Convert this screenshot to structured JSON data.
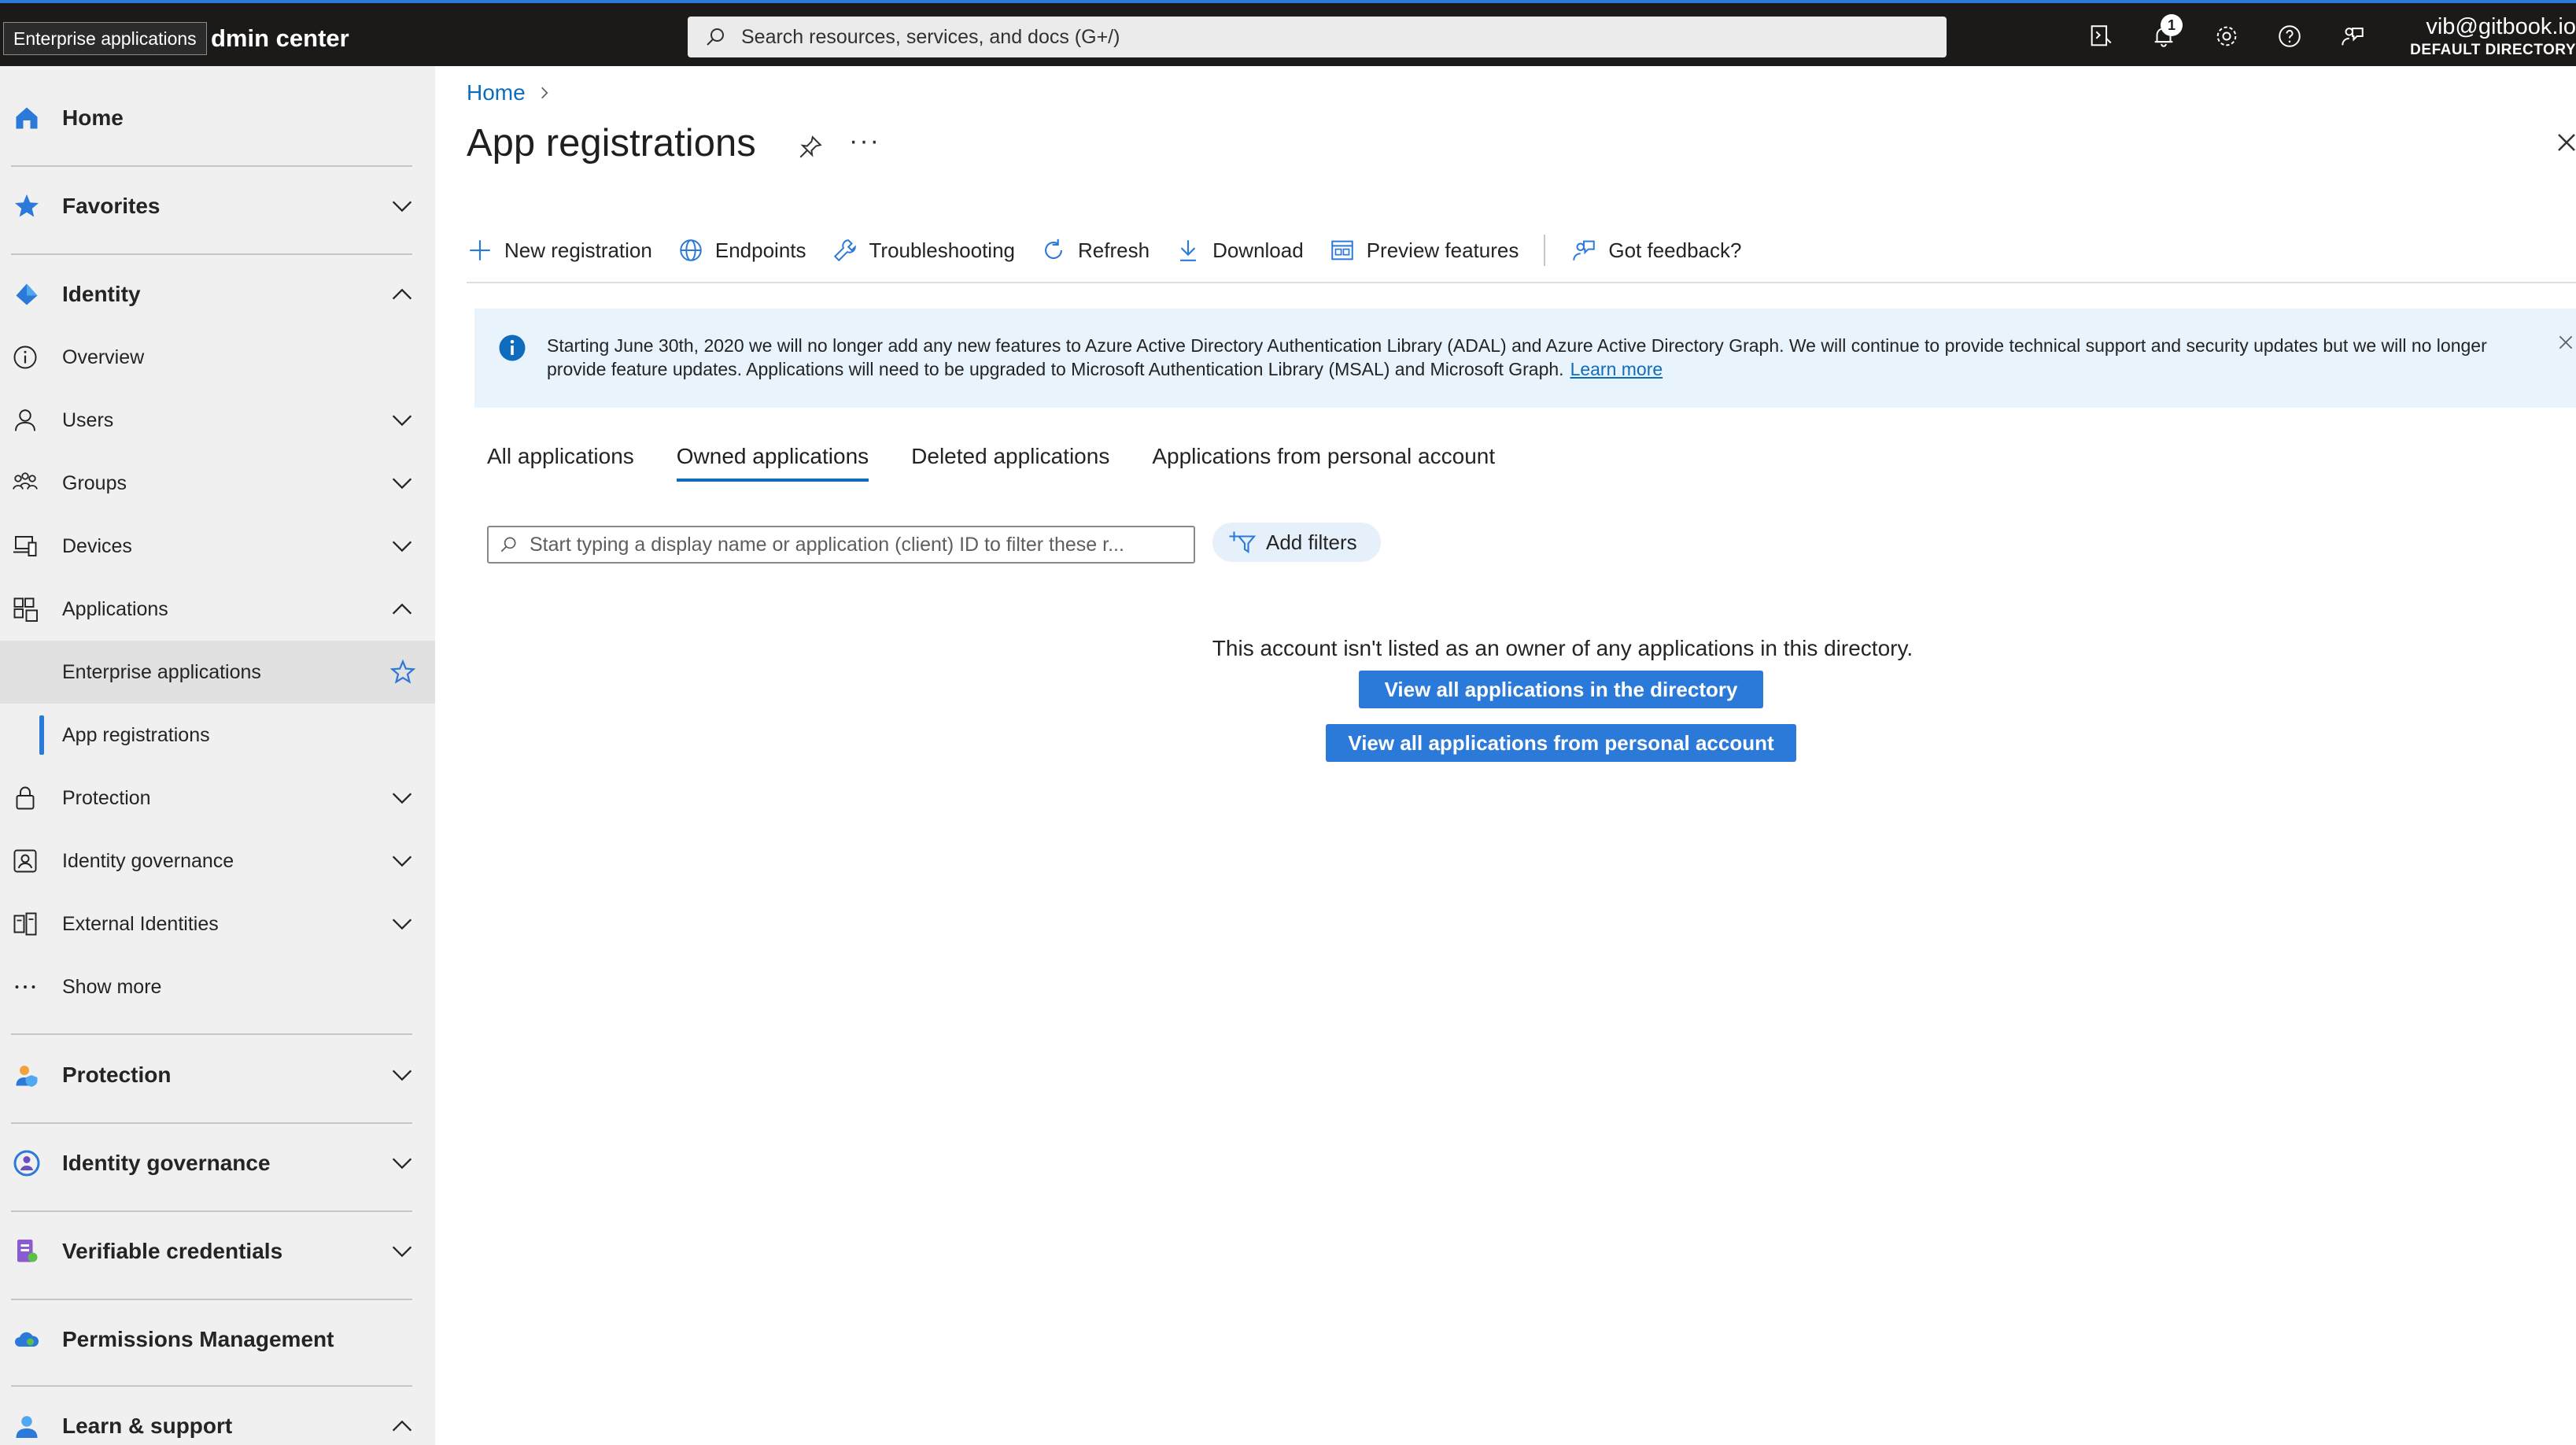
{
  "topbar": {
    "tooltip": "Enterprise applications",
    "title": "dmin center",
    "search_placeholder": "Search resources, services, and docs (G+/)",
    "notification_count": "1",
    "account_email": "vib@gitbook.io",
    "account_directory": "DEFAULT DIRECTORY"
  },
  "sidebar": {
    "home": "Home",
    "favorites": "Favorites",
    "identity": "Identity",
    "items": [
      {
        "label": "Overview"
      },
      {
        "label": "Users"
      },
      {
        "label": "Groups"
      },
      {
        "label": "Devices"
      },
      {
        "label": "Applications"
      },
      {
        "label": "Enterprise applications"
      },
      {
        "label": "App registrations"
      },
      {
        "label": "Protection"
      },
      {
        "label": "Identity governance"
      },
      {
        "label": "External Identities"
      },
      {
        "label": "Show more"
      }
    ],
    "sections": [
      {
        "label": "Protection"
      },
      {
        "label": "Identity governance"
      },
      {
        "label": "Verifiable credentials"
      },
      {
        "label": "Permissions Management"
      },
      {
        "label": "Learn & support"
      }
    ],
    "accent": "#2b79d8"
  },
  "main": {
    "breadcrumb_home": "Home",
    "title": "App registrations",
    "more": "···",
    "toolbar": [
      {
        "label": "New registration",
        "icon": "plus-icon"
      },
      {
        "label": "Endpoints",
        "icon": "globe-icon"
      },
      {
        "label": "Troubleshooting",
        "icon": "wrench-icon"
      },
      {
        "label": "Refresh",
        "icon": "refresh-icon"
      },
      {
        "label": "Download",
        "icon": "download-icon"
      },
      {
        "label": "Preview features",
        "icon": "preview-icon"
      },
      {
        "label": "Got feedback?",
        "icon": "feedback-icon"
      }
    ],
    "banner": {
      "text": "Starting June 30th, 2020 we will no longer add any new features to Azure Active Directory Authentication Library (ADAL) and Azure Active Directory Graph. We will continue to provide technical support and security updates but we will no longer provide feature updates. Applications will need to be upgraded to Microsoft Authentication Library (MSAL) and Microsoft Graph.",
      "link": "Learn more"
    },
    "tabs": [
      {
        "label": "All applications",
        "active": false
      },
      {
        "label": "Owned applications",
        "active": true
      },
      {
        "label": "Deleted applications",
        "active": false
      },
      {
        "label": "Applications from personal account",
        "active": false
      }
    ],
    "filter_placeholder": "Start typing a display name or application (client) ID to filter these r...",
    "add_filters": "Add filters",
    "empty_message": "This account isn't listed as an owner of any applications in this directory.",
    "btn_view_directory": "View all applications in the directory",
    "btn_view_personal": "View all applications from personal account"
  }
}
